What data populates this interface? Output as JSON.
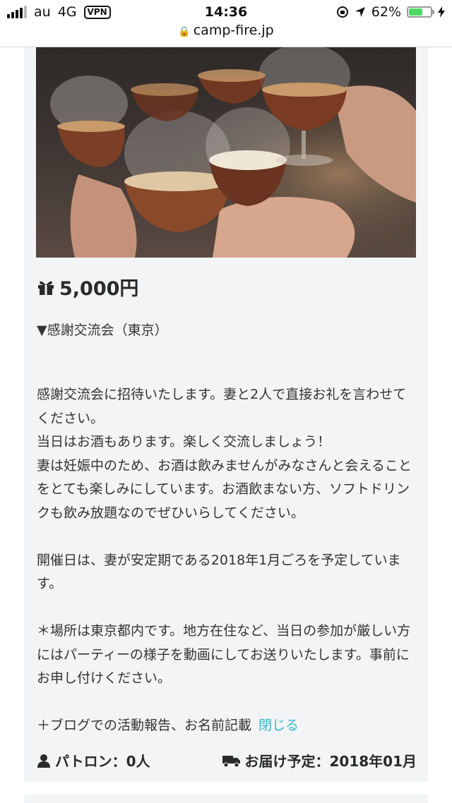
{
  "status_bar": {
    "carrier": "au",
    "network": "4G",
    "vpn": "VPN",
    "time": "14:36",
    "battery": "62%",
    "battery_level": 0.62
  },
  "url_bar": {
    "url": "camp-fire.jp"
  },
  "reward": {
    "price": "5,000円",
    "title": "▼感謝交流会（東京）",
    "description": [
      "感謝交流会に招待いたします。妻と2人で直接お礼を言わせてください。",
      "当日はお酒もあります。楽しく交流しましょう！",
      "妻は妊娠中のため、お酒は飲みませんがみなさんと会えることをとても楽しみにしています。お酒飲まない方、ソフトドリンクも飲み放題なのでぜひいらしてください。",
      "",
      "開催日は、妻が安定期である2018年1月ごろを予定しています。",
      "",
      "＊場所は東京都内です。地方在住など、当日の参加が厳しい方にはパーティーの様子を動画にしてお送りいたします。事前にお申し付けください。",
      "",
      "＋ブログでの活動報告、お名前記載"
    ],
    "close_label": "閉じる",
    "patron_label": "パトロン：0人",
    "delivery_label": "お届け予定：2018年01月"
  }
}
